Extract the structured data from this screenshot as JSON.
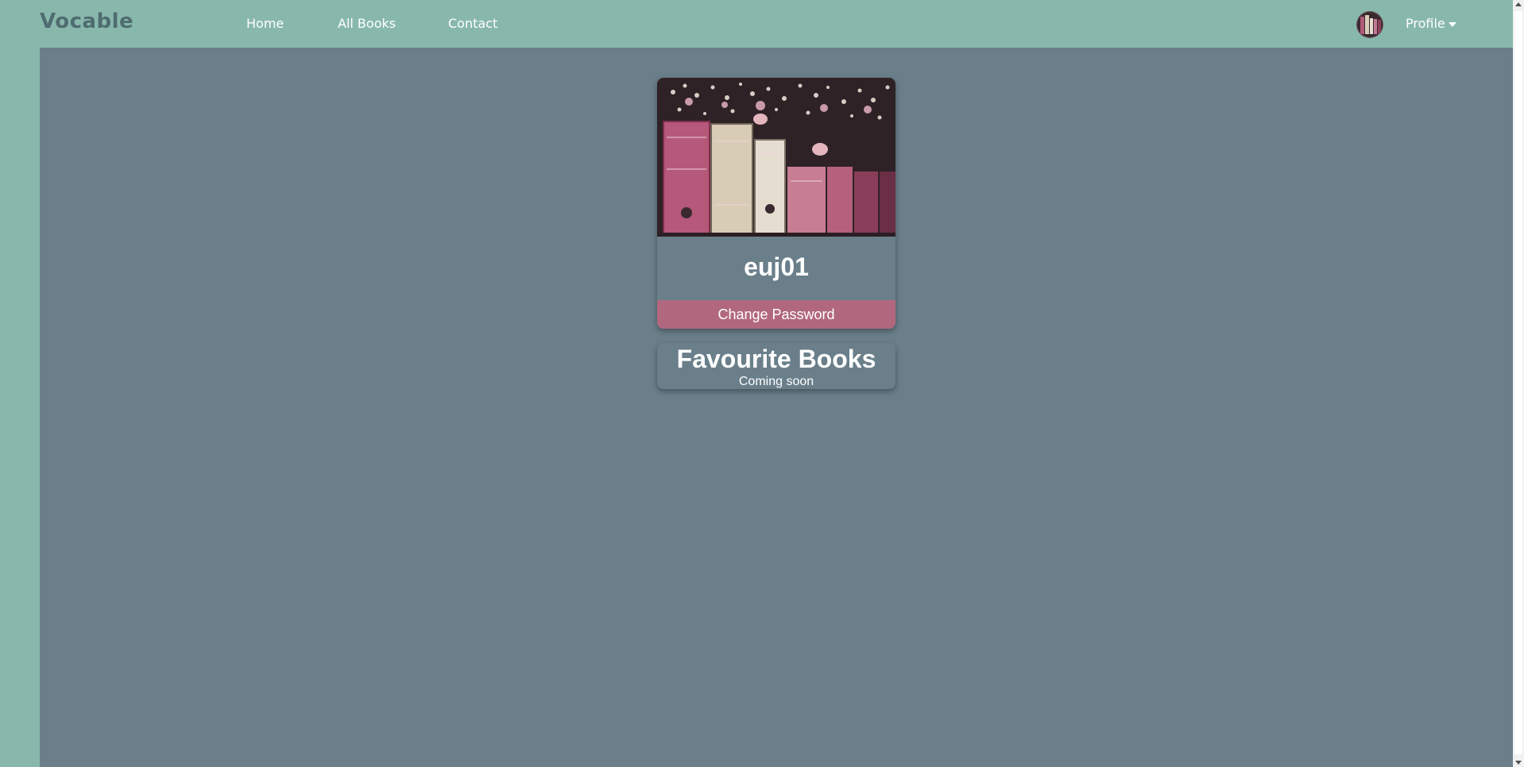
{
  "navbar": {
    "brand": "Vocable",
    "links": [
      "Home",
      "All Books",
      "Contact"
    ],
    "profile_label": "Profile"
  },
  "profile": {
    "username": "euj01",
    "change_password_label": "Change Password",
    "image_icon": "bookshelf-photo"
  },
  "favourites": {
    "title": "Favourite Books",
    "subtitle": "Coming soon"
  },
  "colors": {
    "nav_background": "#88b8ac",
    "main_background": "#6a7f8a",
    "accent_button": "#b1687e",
    "brand_text": "#4f6c70"
  }
}
